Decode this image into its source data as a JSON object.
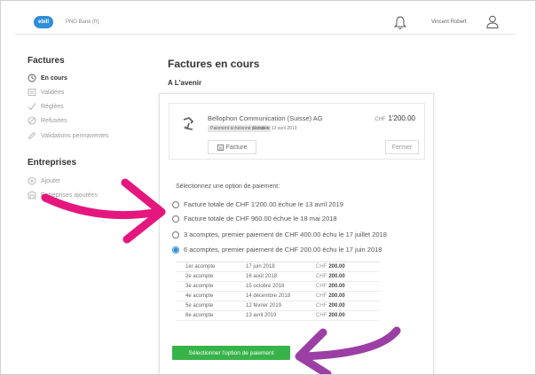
{
  "header": {
    "logo_text": "ebill",
    "bank_name": "PNG Bank (fr)",
    "user_name": "Vincent Robert"
  },
  "sidebar": {
    "invoices_heading": "Factures",
    "invoice_items": [
      {
        "label": "En cours",
        "icon": "clock-icon",
        "active": true
      },
      {
        "label": "Validées",
        "icon": "list-icon",
        "active": false
      },
      {
        "label": "Réglées",
        "icon": "check-icon",
        "active": false
      },
      {
        "label": "Refusées",
        "icon": "refused-icon",
        "active": false
      },
      {
        "label": "Validations permanentes",
        "icon": "pencil-icon",
        "active": false
      }
    ],
    "companies_heading": "Entreprises",
    "company_items": [
      {
        "label": "Ajouter",
        "icon": "add-icon"
      },
      {
        "label": "Entreprises ajoutées",
        "icon": "building-icon"
      }
    ]
  },
  "main": {
    "title": "Factures en cours",
    "subtitle": "A L'avenir",
    "invoice": {
      "company": "Bellophon Communication (Suisse) AG",
      "badge": "Paiement échelonné possible",
      "due": "Echue le 13 avril 2019",
      "currency": "CHF",
      "amount": "1'200.00",
      "facture_button": "Facture",
      "close_button": "Fermer"
    },
    "options_label": "Sélectionnez une option de paiement:",
    "options": [
      {
        "label": "Facture totale de CHF 1'200.00 échue le 13 avril 2019",
        "checked": false
      },
      {
        "label": "Facture totale de CHF 960.00 échue le 18 mai 2018",
        "checked": false
      },
      {
        "label": "3 acomptes, premier paiement de CHF 400.00 échu le 17 juillet 2018",
        "checked": false
      },
      {
        "label": "6 acomptes, premier paiement de CHF 200.00 échu le 17 juin 2018",
        "checked": true
      }
    ],
    "schedule": [
      {
        "n": "1er acompte",
        "date": "17 juin 2018",
        "cur": "CHF",
        "amount": "200.00"
      },
      {
        "n": "2e acompte",
        "date": "16 août 2018",
        "cur": "CHF",
        "amount": "200.00"
      },
      {
        "n": "3e acompte",
        "date": "15 octobre 2018",
        "cur": "CHF",
        "amount": "200.00"
      },
      {
        "n": "4e acompte",
        "date": "14 décembre 2018",
        "cur": "CHF",
        "amount": "200.00"
      },
      {
        "n": "5e acompte",
        "date": "12 février 2019",
        "cur": "CHF",
        "amount": "200.00"
      },
      {
        "n": "6e acompte",
        "date": "13 avril 2019",
        "cur": "CHF",
        "amount": "200.00"
      }
    ],
    "select_button": "Sélectionner l'option de paiement"
  },
  "colors": {
    "accent_blue": "#2f8fd8",
    "button_green": "#38b34a",
    "arrow_pink": "#e5177e",
    "arrow_purple": "#9b3fa4"
  }
}
